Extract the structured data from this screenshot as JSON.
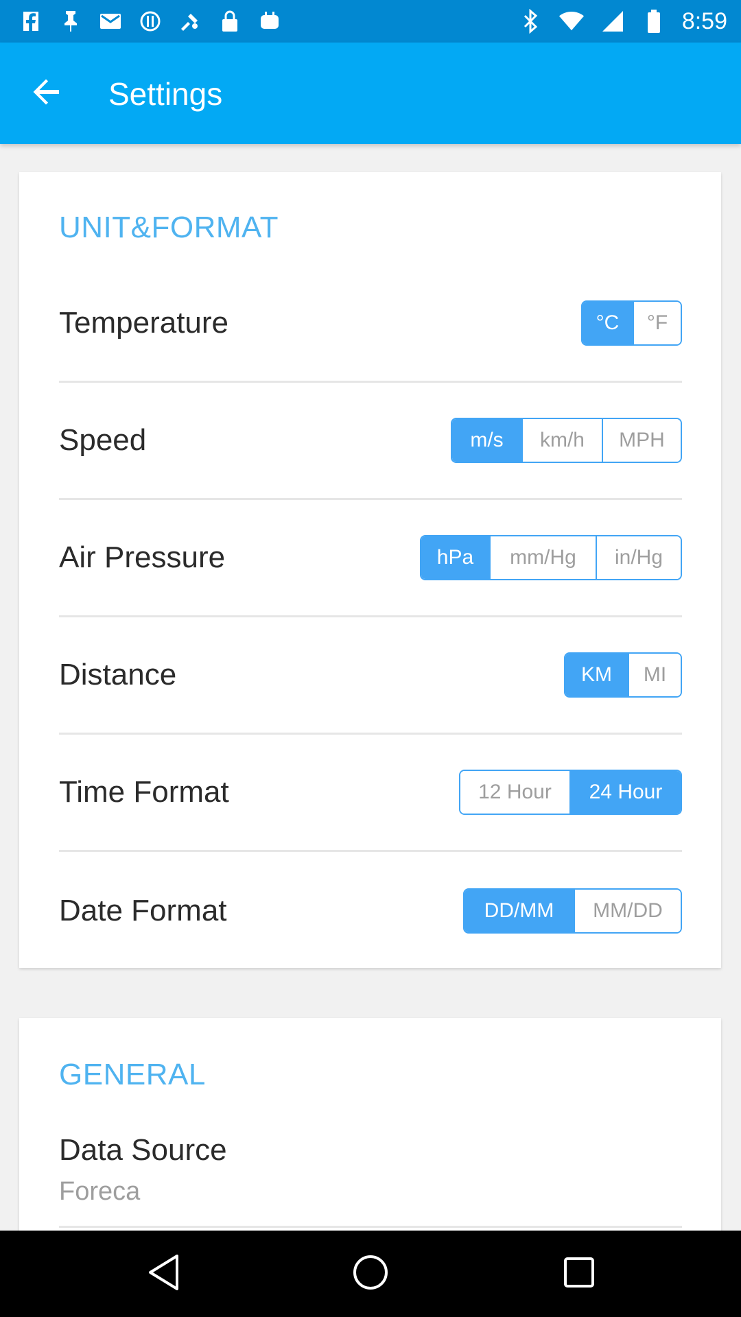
{
  "status_bar": {
    "time": "8:59",
    "left_icons": [
      "facebook-icon",
      "pin-icon",
      "email-icon",
      "alert-icon",
      "fake-gps-icon",
      "lock-icon",
      "android-icon"
    ],
    "right_icons": [
      "bluetooth-icon",
      "wifi-icon",
      "cell-signal-icon",
      "battery-icon"
    ]
  },
  "app_bar": {
    "title": "Settings",
    "back_icon": "arrow-back-icon"
  },
  "unit_format": {
    "title": "UNIT&FORMAT",
    "rows": [
      {
        "label": "Temperature",
        "options": [
          "°C",
          "°F"
        ],
        "selected": "°C"
      },
      {
        "label": "Speed",
        "options": [
          "m/s",
          "km/h",
          "MPH"
        ],
        "selected": "m/s"
      },
      {
        "label": "Air Pressure",
        "options": [
          "hPa",
          "mm/Hg",
          "in/Hg"
        ],
        "selected": "hPa"
      },
      {
        "label": "Distance",
        "options": [
          "KM",
          "MI"
        ],
        "selected": "KM"
      },
      {
        "label": "Time Format",
        "options": [
          "12 Hour",
          "24 Hour"
        ],
        "selected": "24 Hour"
      },
      {
        "label": "Date Format",
        "options": [
          "DD/MM",
          "MM/DD"
        ],
        "selected": "DD/MM"
      }
    ]
  },
  "general": {
    "title": "GENERAL",
    "data_source": {
      "label": "Data Source",
      "value": "Foreca"
    }
  },
  "nav_bar": {
    "icons": [
      "back-triangle-icon",
      "home-circle-icon",
      "recents-square-icon"
    ]
  },
  "colors": {
    "status_bar": "#0288d1",
    "app_bar": "#03a9f4",
    "accent": "#42a5f5",
    "section_title": "#4fb3f0"
  }
}
